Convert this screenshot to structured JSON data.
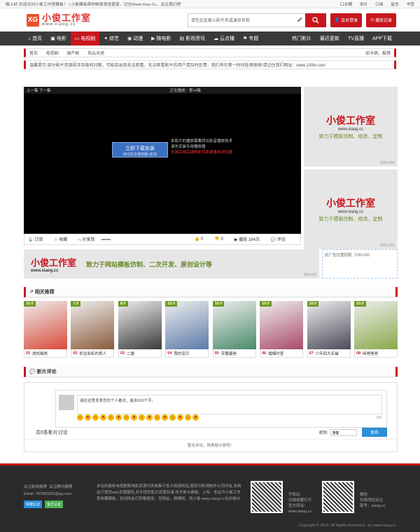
{
  "topbar": {
    "welcome": "晚上好,欢迎访问小俊工作室模板！",
    "notice": "小俊模板带你畅享视觉盛宴，记住Www.Xiao.Cc，关注我们吧",
    "links": [
      "口水棚",
      "求片",
      "订阅",
      "留言",
      "书签"
    ]
  },
  "header": {
    "logo_mark": "XG",
    "logo_text": "小俊工作室",
    "logo_url": "www.xiaog.cc",
    "search_placeholder": "请在此处输入影片名或演员名称",
    "login_label": "会员登录",
    "history_label": "播放记录"
  },
  "nav": {
    "left": [
      {
        "label": "首页",
        "icon": "home-icon"
      },
      {
        "label": "电影"
      },
      {
        "label": "电视剧",
        "active": true
      },
      {
        "label": "综艺"
      },
      {
        "label": "动漫"
      },
      {
        "label": "微电影"
      },
      {
        "label": "影视资讯"
      },
      {
        "label": "云点播"
      },
      {
        "label": "专题"
      }
    ],
    "right": [
      "热门影片",
      "最近更新",
      "TV直播",
      "APP下载"
    ]
  },
  "breadcrumb": {
    "items": [
      "首页",
      "电视剧",
      "国产剧",
      "风云天地"
    ],
    "right": "如卡顿，报错"
  },
  "notice": "温馨提示:部分影片资源因涉及版权问题，可能会出现无法观看，无法观看影片的用户请及时反馈，我们将在第一时间处理谢谢!请记住我们网址：www.199tv.com",
  "player": {
    "prevnext": "上一集 下一集",
    "playing": "正在播放：第14集",
    "download": "立即下载安装",
    "download_sub": "西瓜影音播放器+影视",
    "note": [
      "本影片的播放需要西瓜影音播放技术",
      "请先安装专用播放器"
    ],
    "note_red": "安装完成后请刷新页面或重启浏览器"
  },
  "playbar": {
    "subscribe": "订阅",
    "fav": "收藏",
    "share": "分享到",
    "likes": "0",
    "dislikes": "0",
    "plays": "播放 184次",
    "comment": "评论"
  },
  "side_ads": [
    {
      "brand": "小俊工作室",
      "url": "www.xiaog.cc",
      "slogan": "致力于模板仿制、修改、定制",
      "size": "300x250"
    },
    {
      "brand": "小俊工作室",
      "url": "www.xiaog.cc",
      "slogan": "致力于模板仿制、修改、定制",
      "size": "300x250"
    }
  ],
  "banner": {
    "brand": "小俊工作室",
    "url": "www.xiaog.cc",
    "slogan": "致力于网站模板仿制、二次开发、原创设计等",
    "size": "960x90"
  },
  "adbox": "此广告位置招租（230×90）",
  "rec_title": "相关推荐",
  "recommend": [
    {
      "score": "10.0",
      "num": "01",
      "title": "虎妈猫爸",
      "color": "#d94a3a"
    },
    {
      "score": "7.0",
      "num": "02",
      "title": "抓住彩虹的男人",
      "color": "#8b5a3a"
    },
    {
      "score": "8.0",
      "num": "03",
      "title": "二婚",
      "color": "#3a3a3a"
    },
    {
      "score": "10.0",
      "num": "04",
      "title": "我的宝贝",
      "color": "#5a7aa8"
    },
    {
      "score": "10.0",
      "num": "05",
      "title": "突襲豬爸",
      "color": "#4a8a6a"
    },
    {
      "score": "10.0",
      "num": "06",
      "title": "婚姻时差",
      "color": "#a84a6a"
    },
    {
      "score": "10.0",
      "num": "07",
      "title": "少年四大名捕",
      "color": "#4a4a5a"
    },
    {
      "score": "10.0",
      "num": "08",
      "title": "啼哩爸爸",
      "color": "#88a84a"
    }
  ],
  "comment": {
    "title": "影片评论",
    "placeholder": "请在这里发表您的个人看法，最多200个字。",
    "count": "200",
    "total": "共0条影片讨论",
    "nick_label": "昵称:",
    "nick_value": "游客",
    "send": "发布",
    "empty": "暂无评论，快来抢沙发吧！"
  },
  "footer": {
    "links": [
      "关注新浪微博",
      "关注腾讯微博"
    ],
    "email": "Email: 787850323@qq.com",
    "badges": [
      "快捷认证",
      "官方认证"
    ],
    "desc": "本站的最新电视剧和电影资源均系收集于各大视频网站,版权归影视制作公司所有,本网站只提供web页面服务,并不提供影片资源存储,也不参与录制、上传。本站为小俊工作室收藏模板，欢迎网友们转载使用，您网站，微博网，找小俊 www.xiaog.cc站长统计",
    "qr1": [
      "手机站",
      "扫描收藏打开",
      "官方网站：",
      "www.xiaog.cc"
    ],
    "qr2": [
      "微信",
      "扫描添加关注",
      "家号：xiaog.cc"
    ],
    "copyright": "Copyright © 2015. All Rights Reserved , by www.xiaog.cc"
  }
}
